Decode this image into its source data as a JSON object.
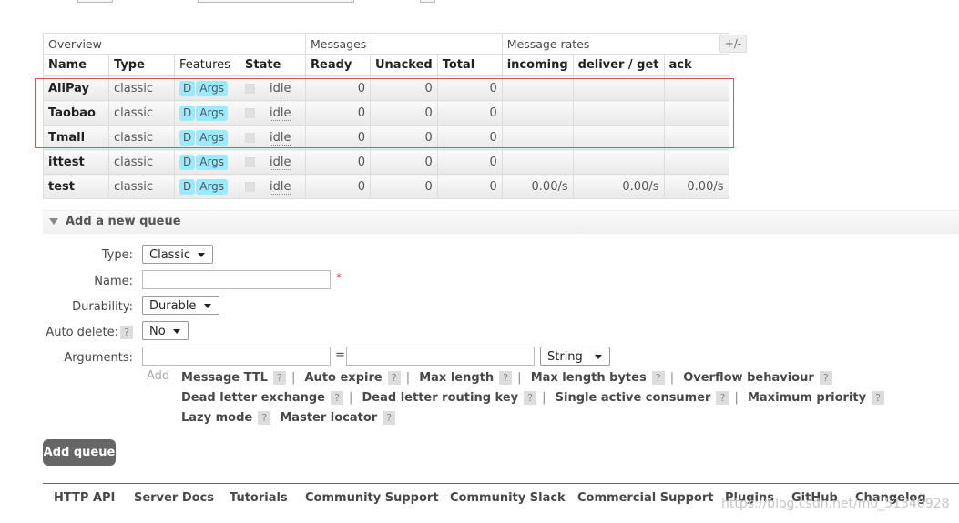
{
  "table": {
    "group_headers": [
      "Overview",
      "Messages",
      "Message rates"
    ],
    "plus_minus": "+/-",
    "columns": [
      "Name",
      "Type",
      "Features",
      "State",
      "Ready",
      "Unacked",
      "Total",
      "incoming",
      "deliver / get",
      "ack"
    ],
    "rows": [
      {
        "name": "AliPay",
        "type": "classic",
        "feature_d": "D",
        "feature_args": "Args",
        "state": "idle",
        "ready": "0",
        "unacked": "0",
        "total": "0",
        "incoming": "",
        "deliver_get": "",
        "ack": ""
      },
      {
        "name": "Taobao",
        "type": "classic",
        "feature_d": "D",
        "feature_args": "Args",
        "state": "idle",
        "ready": "0",
        "unacked": "0",
        "total": "0",
        "incoming": "",
        "deliver_get": "",
        "ack": ""
      },
      {
        "name": "Tmall",
        "type": "classic",
        "feature_d": "D",
        "feature_args": "Args",
        "state": "idle",
        "ready": "0",
        "unacked": "0",
        "total": "0",
        "incoming": "",
        "deliver_get": "",
        "ack": ""
      },
      {
        "name": "ittest",
        "type": "classic",
        "feature_d": "D",
        "feature_args": "Args",
        "state": "idle",
        "ready": "0",
        "unacked": "0",
        "total": "0",
        "incoming": "",
        "deliver_get": "",
        "ack": ""
      },
      {
        "name": "test",
        "type": "classic",
        "feature_d": "D",
        "feature_args": "Args",
        "state": "idle",
        "ready": "0",
        "unacked": "0",
        "total": "0",
        "incoming": "0.00/s",
        "deliver_get": "0.00/s",
        "ack": "0.00/s"
      }
    ]
  },
  "add_queue": {
    "section_title": "Add a new queue",
    "type_label": "Type:",
    "type_value": "Classic",
    "name_label": "Name:",
    "name_value": "",
    "required_mark": "*",
    "durability_label": "Durability:",
    "durability_value": "Durable",
    "auto_delete_label": "Auto delete:",
    "auto_delete_value": "No",
    "arguments_label": "Arguments:",
    "equals": "=",
    "arg_type_value": "String",
    "add_link": "Add",
    "help": "?",
    "separator": "|",
    "argument_shortcuts": [
      [
        "Message TTL",
        "Auto expire",
        "Max length",
        "Max length bytes",
        "Overflow behaviour"
      ],
      [
        "Dead letter exchange",
        "Dead letter routing key",
        "Single active consumer",
        "Maximum priority"
      ],
      [
        "Lazy mode",
        "Master locator"
      ]
    ],
    "submit_label": "Add queue"
  },
  "footer": {
    "links": [
      "HTTP API",
      "Server Docs",
      "Tutorials",
      "Community Support",
      "Community Slack",
      "Commercial Support",
      "Plugins",
      "GitHub",
      "Changelog"
    ]
  },
  "watermark": "https://blog.csdn.net/m0_51340928",
  "colors": {
    "badge": "#99ebff",
    "highlight": "#d9534f",
    "button": "#666666"
  }
}
